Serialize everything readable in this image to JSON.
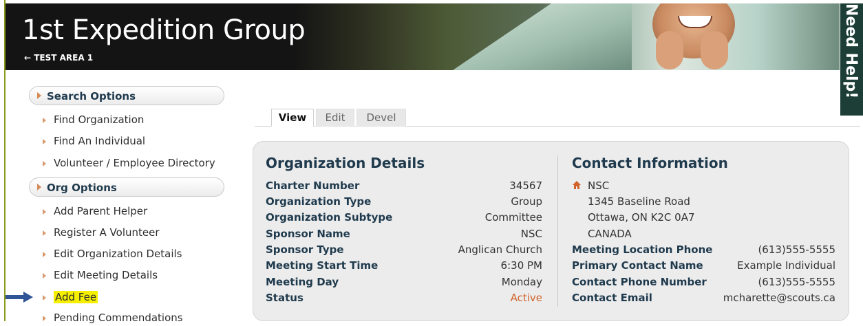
{
  "header": {
    "title": "1st Expedition Group",
    "breadcrumb": "← TEST AREA 1",
    "need_help": "Need Help!"
  },
  "sidebar": {
    "search_heading": "Search Options",
    "search_items": [
      "Find Organization",
      "Find An Individual",
      "Volunteer / Employee Directory"
    ],
    "org_heading": "Org Options",
    "org_items": [
      "Add Parent Helper",
      "Register A Volunteer",
      "Edit Organization Details",
      "Edit Meeting Details",
      "Add Fee",
      "Pending Commendations"
    ]
  },
  "tabs": [
    "View",
    "Edit",
    "Devel"
  ],
  "org_details": {
    "title": "Organization Details",
    "rows": [
      {
        "label": "Charter Number",
        "value": "34567"
      },
      {
        "label": "Organization Type",
        "value": "Group"
      },
      {
        "label": "Organization Subtype",
        "value": "Committee"
      },
      {
        "label": "Sponsor Name",
        "value": "NSC"
      },
      {
        "label": "Sponsor Type",
        "value": "Anglican Church"
      },
      {
        "label": "Meeting Start Time",
        "value": "6:30 PM"
      },
      {
        "label": "Meeting Day",
        "value": "Monday"
      },
      {
        "label": "Status",
        "value": "Active"
      }
    ]
  },
  "contact": {
    "title": "Contact Information",
    "address": [
      "NSC",
      "1345 Baseline Road",
      "Ottawa, ON K2C 0A7",
      "CANADA"
    ],
    "rows": [
      {
        "label": "Meeting Location Phone",
        "value": "(613)555-5555"
      },
      {
        "label": "Primary Contact Name",
        "value": "Example Individual"
      },
      {
        "label": "Contact Phone Number",
        "value": "(613)555-5555"
      },
      {
        "label": "Contact Email",
        "value": "mcharette@scouts.ca"
      }
    ]
  },
  "colors": {
    "accent": "#1f3a4d",
    "status_active": "#d0622a",
    "highlight": "#f6f000",
    "need_help_bg": "#1c3e37"
  }
}
